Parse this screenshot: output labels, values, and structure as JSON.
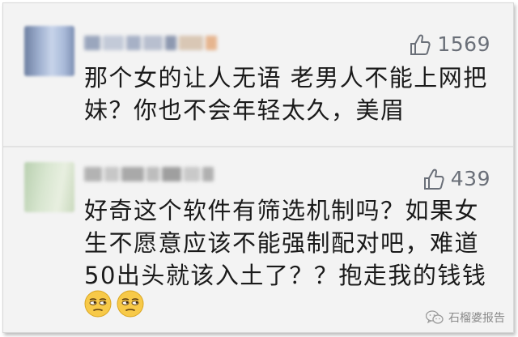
{
  "comments": [
    {
      "likes": "1569",
      "text_lines": [
        "那个女的让人无语 老男人不能上网把",
        "妹？你也不会年轻太久，美眉"
      ],
      "emojis": []
    },
    {
      "likes": "439",
      "text_lines": [
        "好奇这个软件有筛选机制吗？如果女",
        "生不愿意应该不能强制配对吧，难道",
        "50出头就该入土了？？抱走我的钱钱"
      ],
      "emojis": [
        "unamused-face-icon",
        "unamused-face-icon"
      ]
    }
  ],
  "watermark": {
    "text": "石榴婆报告",
    "icon": "wechat-icon"
  },
  "colors": {
    "background": "#f3f3f3",
    "text": "#1a1a1a",
    "likes": "#6a6f78",
    "divider": "#e2e2e2"
  }
}
